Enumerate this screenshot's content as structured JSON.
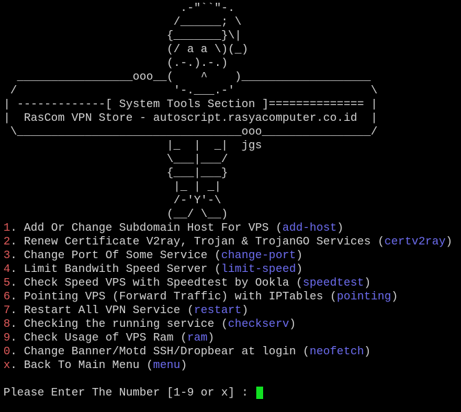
{
  "banner": [
    "                          .-\"``\"-.",
    "                         /______; \\",
    "                        {_______}\\|",
    "                        (/ a a \\)(_)",
    "                        (.-.).-.)",
    "  _________________ooo__(    ^    )___________________",
    " /                       '-.___.-'                    \\",
    "| -------------[ System Tools Section ]============== |",
    "|  RasCom VPN Store - autoscript.rasyacomputer.co.id  |",
    " \\_________________________________ooo________________/",
    "                        |_  |  _|  jgs",
    "                        \\___|___/",
    "                        {___|___}",
    "                         |_ | _|",
    "                         /-'Y'-\\",
    "                        (__/ \\__)"
  ],
  "menu": [
    {
      "num": "1",
      "label": ". Add Or Change Subdomain Host For VPS (",
      "cmd": "add-host",
      "close": ")"
    },
    {
      "num": "2",
      "label": ". Renew Certificate V2ray, Trojan & TrojanGO Services (",
      "cmd": "certv2ray",
      "close": ")"
    },
    {
      "num": "3",
      "label": ". Change Port Of Some Service (",
      "cmd": "change-port",
      "close": ")"
    },
    {
      "num": "4",
      "label": ". Limit Bandwith Speed Server (",
      "cmd": "limit-speed",
      "close": ")"
    },
    {
      "num": "5",
      "label": ". Check Speed VPS with Speedtest by Ookla (",
      "cmd": "speedtest",
      "close": ")"
    },
    {
      "num": "6",
      "label": ". Pointing VPS (Forward Traffic) with IPTables (",
      "cmd": "pointing",
      "close": ")"
    },
    {
      "num": "7",
      "label": ". Restart All VPN Service (",
      "cmd": "restart",
      "close": ")"
    },
    {
      "num": "8",
      "label": ". Checking the running service (",
      "cmd": "checkserv",
      "close": ")"
    },
    {
      "num": "9",
      "label": ". Check Usage of VPS Ram (",
      "cmd": "ram",
      "close": ")"
    },
    {
      "num": "0",
      "label": ". Change Banner/Motd SSH/Dropbear at login (",
      "cmd": "neofetch",
      "close": ")"
    },
    {
      "num": "x",
      "label": ". Back To Main Menu (",
      "cmd": "menu",
      "close": ")"
    }
  ],
  "prompt": {
    "text": "Please Enter The Number [1-9 or x] : "
  },
  "colors": {
    "background": "#000000",
    "text": "#d4d4d4",
    "number": "#e05b5b",
    "command": "#6d6df0",
    "cursor": "#11e022"
  }
}
